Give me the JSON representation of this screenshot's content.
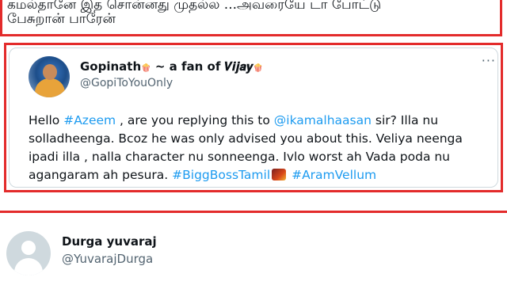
{
  "previous_tweet": {
    "line1": "கமல்தானே இத சொன்னது முதல்ல ...அவரையே டா போட்டு",
    "line2": "பேசுறான் பாரேன்"
  },
  "quoted_tweet": {
    "display_name": "Gopinath",
    "name_badge": "🍿",
    "name_suffix": "~ a fan of",
    "fan_of": "𝑽𝒊𝒋𝒂𝒚",
    "name_badge_end": "🍿",
    "handle": "@GopiToYouOnly",
    "menu": "···",
    "text": {
      "hello": "Hello ",
      "hashtag_azeem": "#Azeem",
      "part1": " , are you replying this to ",
      "mention": "@ikamalhaasan",
      "part2": " sir? Illa nu solladheenga. Bcoz he was only advised you about this. Veliya neenga ipadi illa , nalla character nu sonneenga. Ivlo worst ah Vada poda nu agangaram ah pesura. ",
      "hashtag_bb": "#BiggBossTamil",
      "hashtag_aram": "#AramVellum"
    }
  },
  "reply_user": {
    "display_name": "Durga yuvaraj",
    "handle": "@YuvarajDurga"
  },
  "colors": {
    "highlight_border": "#e32b2b",
    "link": "#1d9bf0",
    "secondary_text": "#536471"
  },
  "icons": {
    "menu": "more-icon",
    "avatar_default": "default-avatar-icon"
  }
}
